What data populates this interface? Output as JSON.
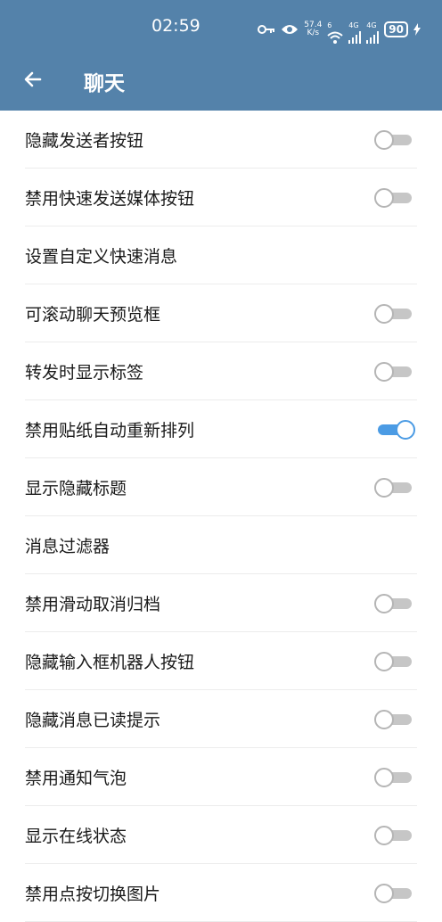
{
  "status_bar": {
    "time": "02:59",
    "net_speed_value": "57.4",
    "net_speed_unit": "K/s",
    "signal_1": "4G",
    "signal_2": "4G",
    "battery": "90",
    "wifi_label": "6"
  },
  "app_bar": {
    "title": "聊天",
    "back_icon": "arrow-left-icon"
  },
  "colors": {
    "header_bg": "#5482aa",
    "toggle_on": "#4b9be4",
    "toggle_off": "#c6c6c6"
  },
  "settings": [
    {
      "label": "隐藏发送者按钮",
      "has_toggle": true,
      "on": false
    },
    {
      "label": "禁用快速发送媒体按钮",
      "has_toggle": true,
      "on": false
    },
    {
      "label": "设置自定义快速消息",
      "has_toggle": false
    },
    {
      "label": "可滚动聊天预览框",
      "has_toggle": true,
      "on": false
    },
    {
      "label": "转发时显示标签",
      "has_toggle": true,
      "on": false
    },
    {
      "label": "禁用贴纸自动重新排列",
      "has_toggle": true,
      "on": true
    },
    {
      "label": "显示隐藏标题",
      "has_toggle": true,
      "on": false
    },
    {
      "label": "消息过滤器",
      "has_toggle": false
    },
    {
      "label": "禁用滑动取消归档",
      "has_toggle": true,
      "on": false
    },
    {
      "label": "隐藏输入框机器人按钮",
      "has_toggle": true,
      "on": false
    },
    {
      "label": "隐藏消息已读提示",
      "has_toggle": true,
      "on": false
    },
    {
      "label": "禁用通知气泡",
      "has_toggle": true,
      "on": false
    },
    {
      "label": "显示在线状态",
      "has_toggle": true,
      "on": false
    },
    {
      "label": "禁用点按切换图片",
      "has_toggle": true,
      "on": false
    }
  ]
}
